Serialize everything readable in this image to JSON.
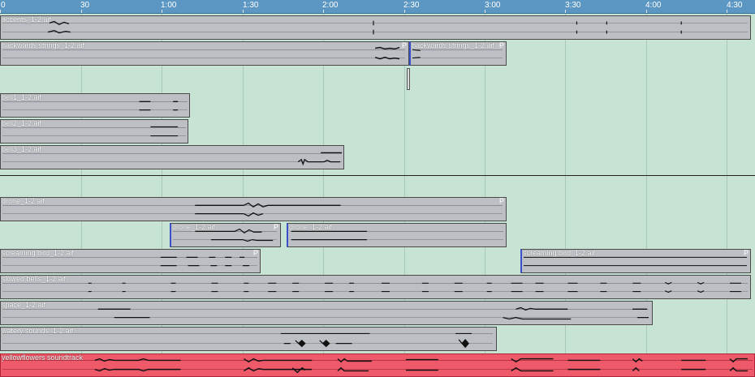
{
  "ruler": {
    "ticks": [
      "0",
      "30",
      "1:00",
      "1:30",
      "2:00",
      "2:30",
      "3:00",
      "3:30",
      "4:00",
      "4:30"
    ]
  },
  "clips": {
    "accents": "accents_1-2.aif",
    "backwards1": "backwards strings_1-2.aif",
    "backwards2": "backwards strings_1-2.aif",
    "bell1": "bell1_1-2.aif",
    "bell2": "bell2_1-2.aif",
    "bell3": "bell3_1-2.aif",
    "drone1": "drone_1-2.aif",
    "drone2": "drone_1-2.aif",
    "drone3": "drone_1-2.aif",
    "screaming1": "screaming bird_1-2.aif",
    "screaming2": "screaming bird_1-2.aif",
    "slowed": "slowed bells_1-2.aif",
    "space": "space_1-2.aif",
    "watery": "watery sounds_1-2.aif",
    "yellowflowers": "yellowflowers soundtrack"
  },
  "marker": "P",
  "colors": {
    "ruler": "#5c97c3",
    "background": "#c6e3d3",
    "clip": "#bcc0c4",
    "highlight_clip": "#ee5a6a"
  }
}
